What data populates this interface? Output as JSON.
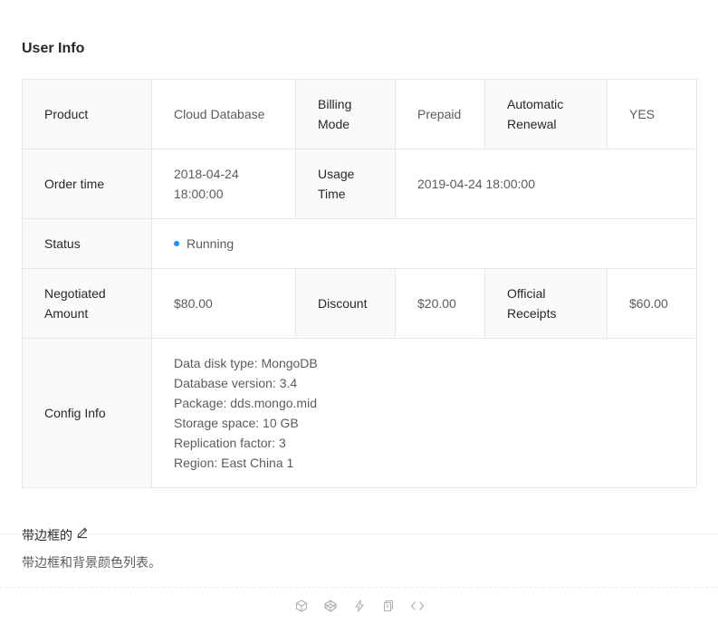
{
  "header": {
    "title": "User Info"
  },
  "rows": {
    "r1": {
      "product_label": "Product",
      "product_value": "Cloud Database",
      "billing_label": "Billing Mode",
      "billing_value": "Prepaid",
      "renewal_label": "Automatic Renewal",
      "renewal_value": "YES"
    },
    "r2": {
      "order_label": "Order time",
      "order_value": "2018-04-24 18:00:00",
      "usage_label": "Usage Time",
      "usage_value": "2019-04-24 18:00:00"
    },
    "r3": {
      "status_label": "Status",
      "status_value": "Running",
      "status_color": "#1890ff"
    },
    "r4": {
      "negotiated_label": "Negotiated Amount",
      "negotiated_value": "$80.00",
      "discount_label": "Discount",
      "discount_value": "$20.00",
      "receipts_label": "Official Receipts",
      "receipts_value": "$60.00"
    },
    "r5": {
      "config_label": "Config Info",
      "config_lines": [
        "Data disk type: MongoDB",
        "Database version: 3.4",
        "Package: dds.mongo.mid",
        "Storage space: 10 GB",
        "Replication factor: 3",
        "Region: East China 1"
      ]
    }
  },
  "section": {
    "title": "带边框的",
    "description": "带边框和背景颜色列表。",
    "edit_icon": "edit-icon"
  },
  "actions": [
    "codesandbox-icon",
    "codepen-icon",
    "thunderbolt-icon",
    "copy-icon",
    "code-icon"
  ]
}
